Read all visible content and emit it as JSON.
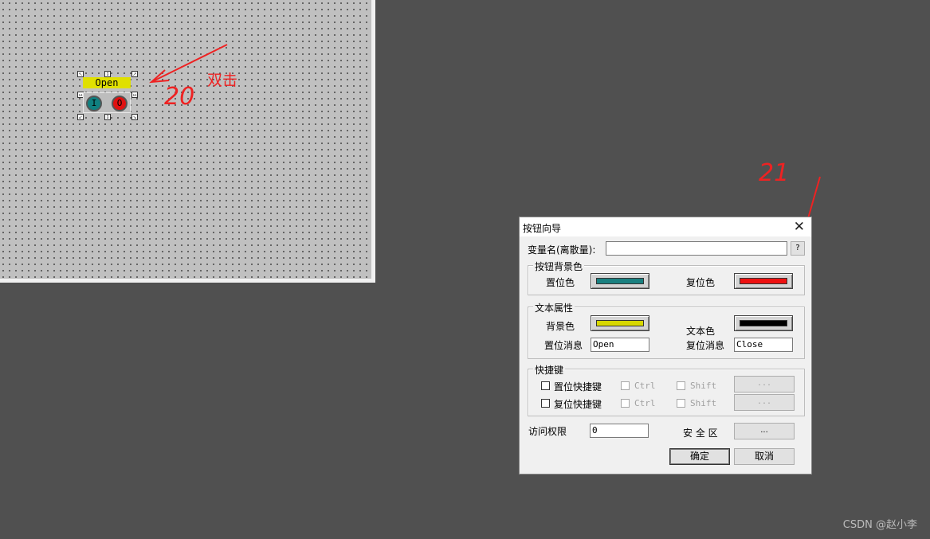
{
  "canvas_object": {
    "label": "Open",
    "knob_on_symbol": "I",
    "knob_off_symbol": "O"
  },
  "annotations": {
    "double_click": "双击",
    "step_20": "20",
    "step_21": "21"
  },
  "dialog": {
    "title": "按钮向导",
    "close_glyph": "✕",
    "variable_label": "变量名(离散量):",
    "variable_value": "",
    "help_button": "?",
    "bg_group": {
      "title": "按钮背景色",
      "set_color_label": "置位色",
      "reset_color_label": "复位色",
      "set_color": "#1a8080",
      "reset_color": "#ee1111"
    },
    "text_group": {
      "title": "文本属性",
      "bg_color_label": "背景色",
      "text_color_label": "文本色",
      "bg_color": "#d8d800",
      "text_color": "#000000",
      "set_msg_label": "置位消息",
      "set_msg_value": "Open",
      "reset_msg_label": "复位消息",
      "reset_msg_value": "Close"
    },
    "shortcut_group": {
      "title": "快捷键",
      "rows": [
        {
          "label": "置位快捷键",
          "ctrl": "Ctrl",
          "shift": "Shift",
          "button": "..."
        },
        {
          "label": "复位快捷键",
          "ctrl": "Ctrl",
          "shift": "Shift",
          "button": "..."
        }
      ]
    },
    "access_label": "访问权限",
    "access_value": "0",
    "security_label": "安 全 区",
    "security_button": "...",
    "ok_button": "确定",
    "cancel_button": "取消"
  },
  "watermark": "CSDN @赵小李",
  "colors": {
    "background": "#505050",
    "annotation": "#ee2222"
  }
}
